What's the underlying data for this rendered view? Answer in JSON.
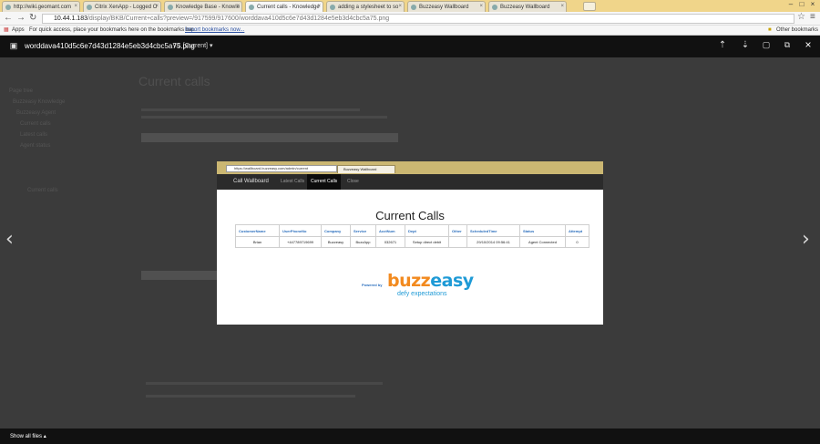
{
  "browser": {
    "tabs": [
      {
        "title": "http://wiki.geomant.com"
      },
      {
        "title": "Citrix XenApp - Logged O"
      },
      {
        "title": "Knowledge Base - Knowle"
      },
      {
        "title": "Current calls - Knowledge"
      },
      {
        "title": "adding a stylesheet to so"
      },
      {
        "title": "Buzzeasy Wallboard"
      },
      {
        "title": "Buzzeasy Wallboard"
      }
    ],
    "url_host": "10.44.1.183",
    "url_path": "/display/BKB/Current+calls?preview=/917599/917600/worddava410d5c6e7d43d1284e5eb3d4cbc5a75.png",
    "bookmarks": {
      "apps": "Apps",
      "hint": "For quick access, place your bookmarks here on the bookmarks bar.",
      "import": "Import bookmarks now...",
      "other": "Other bookmarks"
    }
  },
  "viewer": {
    "file_name": "worddava410d5c6e7d43d1284e5eb3d4cbc5a75.png",
    "version": "v.1 [Current]",
    "show_all": "Show all files",
    "background_page": {
      "title": "Current calls",
      "sidebar": [
        "Page tree",
        "Buzzeasy Knowledge",
        "Buzzeasy Agent",
        "Current calls",
        "Latest calls",
        "Agent status",
        "Current calls"
      ]
    }
  },
  "screenshot": {
    "url": "https://wallboard.buzzeasy.com/admin/current",
    "tab_title": "Buzzeasy Wallboard",
    "nav": {
      "brand": "Call Wallboard",
      "items": [
        "Latest Calls",
        "Current Calls",
        "Close"
      ],
      "active_index": 1
    },
    "heading": "Current Calls",
    "table": {
      "headers": [
        "CustomerName",
        "UserPhoneNo",
        "Company",
        "Service",
        "AcctNum",
        "Dept",
        "Other",
        "ScheduledTime",
        "Status",
        "Attempt"
      ],
      "rows": [
        [
          "Brian",
          "+447789719699",
          "Buzzeasy",
          "BuzzApp",
          "032671",
          "Setup direct debit",
          "",
          "29/10/2014 09:56:41",
          "Agent Connected",
          "0"
        ]
      ]
    },
    "powered_by": "Powered by",
    "logo": {
      "part1": "buzz",
      "part2": "easy",
      "tagline": "defy expectations"
    }
  },
  "colors": {
    "viewer_bg": "#3b3b3b",
    "toolbar": "#111111",
    "link_blue": "#2a6ebd",
    "logo_orange": "#f28a1f",
    "logo_blue": "#1e9ad6"
  }
}
